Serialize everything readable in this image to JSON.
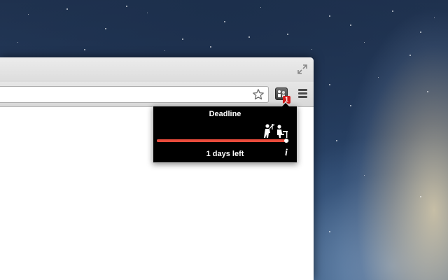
{
  "desktop": {
    "wallpaper": "mountain-lion-galaxy"
  },
  "browser": {
    "titlebar": {
      "fullscreen_icon": "fullscreen-arrows-icon"
    },
    "toolbar": {
      "address_value": "",
      "bookmark_icon": "star-outline-icon",
      "extension": {
        "icon": "people-at-desk-icon",
        "badge_text": "1",
        "badge_color": "#d21c1c"
      },
      "menu_icon": "hamburger-menu-icon"
    }
  },
  "popup": {
    "title": "Deadline",
    "icon": "figures-with-flag-icon",
    "progress_fraction": 0.98,
    "progress_color": "#e94b3c",
    "status_text": "1 days left",
    "info_label": "i"
  }
}
